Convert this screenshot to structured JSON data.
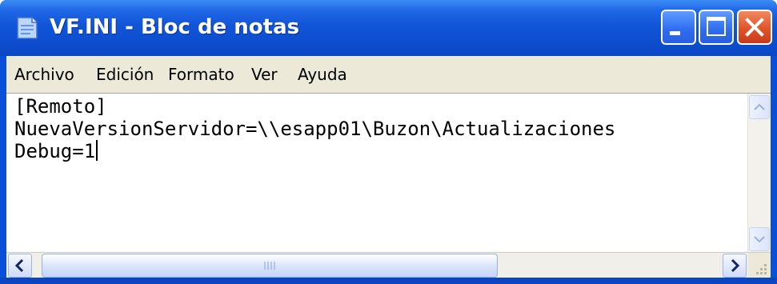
{
  "window": {
    "title": "VF.INI - Bloc de notas",
    "icon": "notepad-icon",
    "controls": [
      "minimize-icon",
      "maximize-icon",
      "close-icon"
    ]
  },
  "menu": {
    "items": [
      "Archivo",
      "Edición",
      "Formato",
      "Ver",
      "Ayuda"
    ]
  },
  "editor": {
    "lines": [
      "[Remoto]",
      "NuevaVersionServidor=\\\\esapp01\\Buzon\\Actualizaciones",
      "Debug=1"
    ]
  },
  "colors": {
    "titlebar": "#0d4fd0",
    "close_button": "#e0542a",
    "menubar": "#ece9d8"
  }
}
